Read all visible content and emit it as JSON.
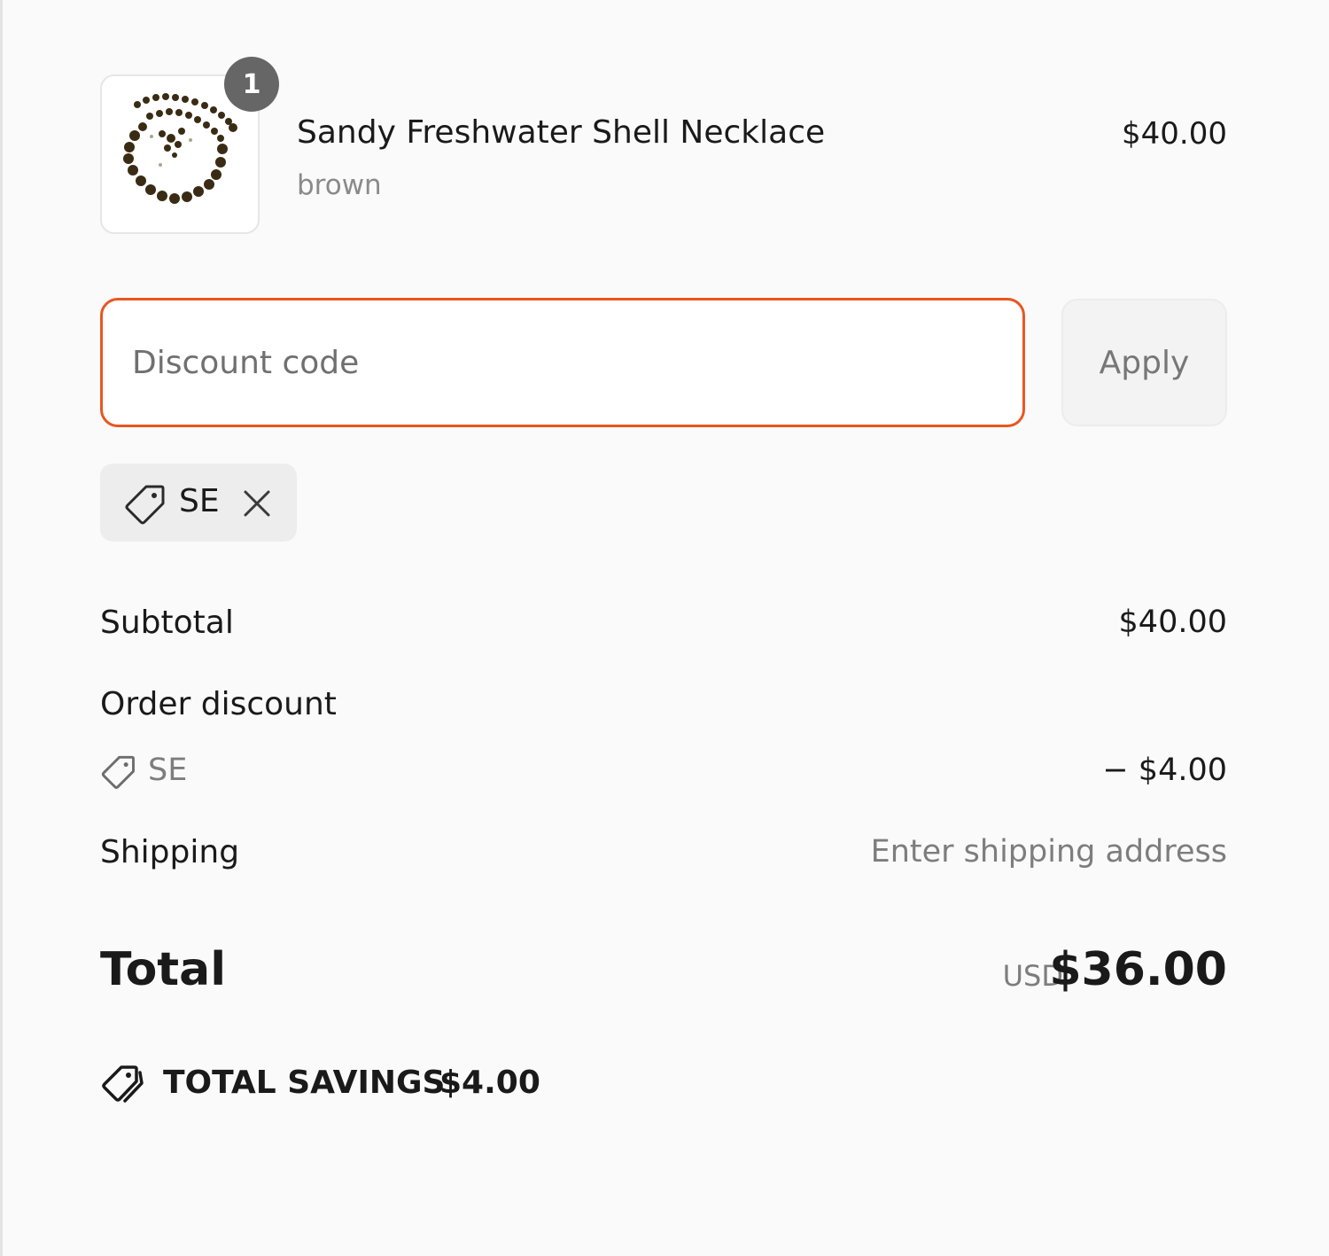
{
  "product": {
    "quantity": "1",
    "name": "Sandy Freshwater Shell Necklace",
    "variant": "brown",
    "price": "$40.00"
  },
  "discount": {
    "placeholder": "Discount code",
    "value": "",
    "apply_label": "Apply",
    "applied_code": "SE"
  },
  "summary": {
    "subtotal_label": "Subtotal",
    "subtotal_value": "$40.00",
    "order_discount_label": "Order discount",
    "order_discount_code": "SE",
    "order_discount_value": "− $4.00",
    "shipping_label": "Shipping",
    "shipping_value": "Enter shipping address",
    "total_label": "Total",
    "total_currency": "USD",
    "total_value": "$36.00",
    "savings_label": "TOTAL SAVINGS",
    "savings_value": "$4.00"
  },
  "colors": {
    "focus_border": "#e8571f",
    "badge": "#666666",
    "muted_text": "#7d7d7d"
  }
}
